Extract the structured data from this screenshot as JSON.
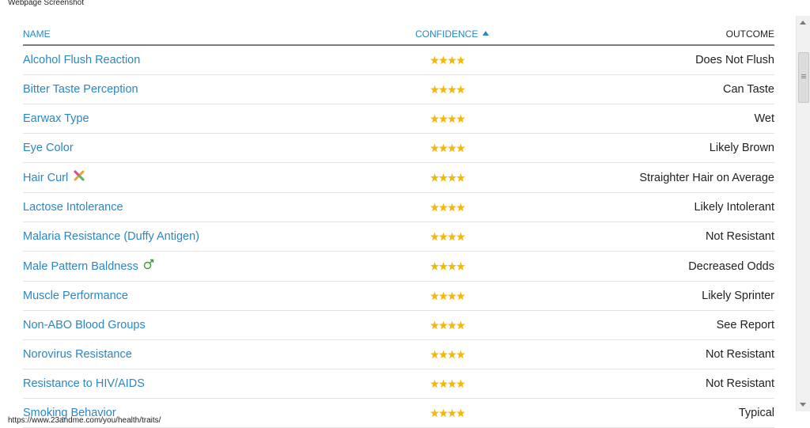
{
  "window": {
    "title": "Webpage Screenshot",
    "url": "https://www.23andme.com/you/health/traits/"
  },
  "table": {
    "headers": {
      "name": "NAME",
      "confidence": "CONFIDENCE",
      "outcome": "OUTCOME"
    },
    "sort": {
      "column": "confidence",
      "direction": "ascending"
    },
    "rows": [
      {
        "name": "Alcohol Flush Reaction",
        "stars": 4,
        "outcome": "Does Not Flush",
        "icon": ""
      },
      {
        "name": "Bitter Taste Perception",
        "stars": 4,
        "outcome": "Can Taste",
        "icon": ""
      },
      {
        "name": "Earwax Type",
        "stars": 4,
        "outcome": "Wet",
        "icon": ""
      },
      {
        "name": "Eye Color",
        "stars": 4,
        "outcome": "Likely Brown",
        "icon": ""
      },
      {
        "name": "Hair Curl",
        "stars": 4,
        "outcome": "Straighter Hair on Average",
        "icon": "ancestry-cross-icon"
      },
      {
        "name": "Lactose Intolerance",
        "stars": 4,
        "outcome": "Likely Intolerant",
        "icon": ""
      },
      {
        "name": "Malaria Resistance (Duffy Antigen)",
        "stars": 4,
        "outcome": "Not Resistant",
        "icon": ""
      },
      {
        "name": "Male Pattern Baldness",
        "stars": 4,
        "outcome": "Decreased Odds",
        "icon": "male-symbol-icon"
      },
      {
        "name": "Muscle Performance",
        "stars": 4,
        "outcome": "Likely Sprinter",
        "icon": ""
      },
      {
        "name": "Non-ABO Blood Groups",
        "stars": 4,
        "outcome": "See Report",
        "icon": ""
      },
      {
        "name": "Norovirus Resistance",
        "stars": 4,
        "outcome": "Not Resistant",
        "icon": ""
      },
      {
        "name": "Resistance to HIV/AIDS",
        "stars": 4,
        "outcome": "Not Resistant",
        "icon": ""
      },
      {
        "name": "Smoking Behavior",
        "stars": 4,
        "outcome": "Typical",
        "icon": ""
      }
    ]
  },
  "colors": {
    "link": "#2b87c3",
    "star": "#f2b90c",
    "text": "#222222",
    "male_icon": "#3a9b3a"
  }
}
